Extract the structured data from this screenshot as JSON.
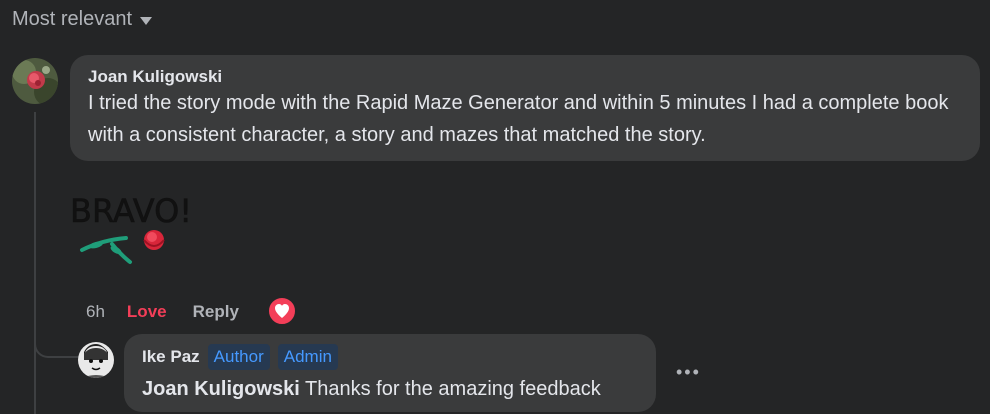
{
  "sort": {
    "label": "Most relevant"
  },
  "comment": {
    "author": "Joan Kuligowski",
    "text": "I tried the story mode with the Rapid Maze Generator and within 5 minutes I had a complete book with a consistent character, a story and mazes that matched the story.",
    "sticker": {
      "text": "BRAVO!",
      "icon": "rose-sticker"
    },
    "time": "6h",
    "reaction_label": "Love",
    "reply_label": "Reply",
    "reaction_icon": "heart-icon"
  },
  "reply": {
    "author": "Ike Paz",
    "badges": [
      "Author",
      "Admin"
    ],
    "mention": "Joan Kuligowski",
    "text": " Thanks for the amazing feedback",
    "more_icon": "more-options-icon"
  },
  "colors": {
    "background": "#242526",
    "bubble": "#3a3b3c",
    "love": "#f33e58",
    "badge_text": "#4599ff"
  }
}
